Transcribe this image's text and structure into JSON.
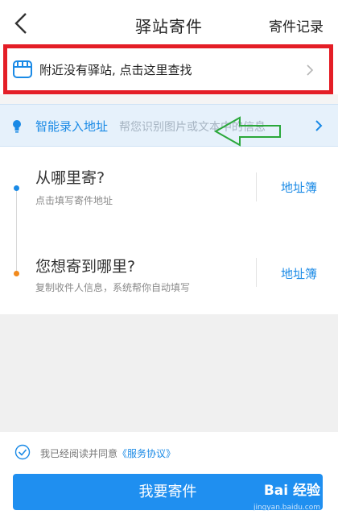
{
  "header": {
    "title": "驿站寄件",
    "records_label": "寄件记录"
  },
  "station_banner": {
    "text": "附近没有驿站, 点击这里查找"
  },
  "smart_input": {
    "label": "智能录入地址",
    "hint": "帮您识别图片或文本中的信息"
  },
  "sender": {
    "question": "从哪里寄?",
    "subtitle": "点击填写寄件地址",
    "address_book_label": "地址簿"
  },
  "recipient": {
    "question": "您想寄到哪里?",
    "subtitle": "复制收件人信息，系统帮你自动填写",
    "address_book_label": "地址簿"
  },
  "agreement": {
    "prefix": "我已经阅读并同意",
    "link": "《服务协议》"
  },
  "submit": {
    "label": "我要寄件"
  },
  "watermark": {
    "brand": "Bai 经验",
    "url": "jingyan.baidu.com"
  },
  "colors": {
    "accent_blue": "#1f8ff0",
    "highlight_red": "#e41e26",
    "annotation_green": "#2aa83a",
    "orange_dot": "#f28a1c"
  }
}
